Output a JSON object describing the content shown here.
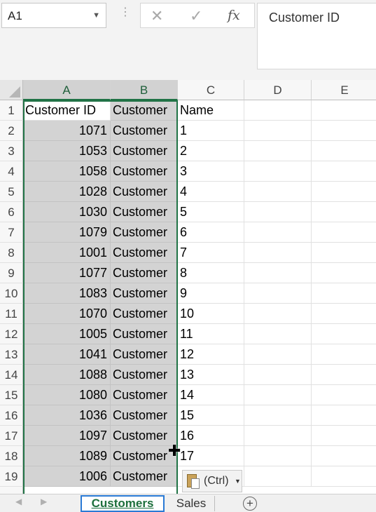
{
  "name_box": {
    "value": "A1",
    "dropdown_icon": "chevron-down-icon"
  },
  "formula_bar": {
    "cancel_icon": "close-icon",
    "enter_icon": "check-icon",
    "insert_function_icon": "fx-icon",
    "insert_function_label": "fx",
    "content": "Customer ID"
  },
  "columns": [
    "A",
    "B",
    "C",
    "D",
    "E"
  ],
  "rows": [
    {
      "n": "1",
      "a": "Customer ID",
      "b": "Customer",
      "c": "Name"
    },
    {
      "n": "2",
      "a": "1071",
      "b": "Customer",
      "c": "1"
    },
    {
      "n": "3",
      "a": "1053",
      "b": "Customer",
      "c": "2"
    },
    {
      "n": "4",
      "a": "1058",
      "b": "Customer",
      "c": "3"
    },
    {
      "n": "5",
      "a": "1028",
      "b": "Customer",
      "c": "4"
    },
    {
      "n": "6",
      "a": "1030",
      "b": "Customer",
      "c": "5"
    },
    {
      "n": "7",
      "a": "1079",
      "b": "Customer",
      "c": "6"
    },
    {
      "n": "8",
      "a": "1001",
      "b": "Customer",
      "c": "7"
    },
    {
      "n": "9",
      "a": "1077",
      "b": "Customer",
      "c": "8"
    },
    {
      "n": "10",
      "a": "1083",
      "b": "Customer",
      "c": "9"
    },
    {
      "n": "11",
      "a": "1070",
      "b": "Customer",
      "c": "10"
    },
    {
      "n": "12",
      "a": "1005",
      "b": "Customer",
      "c": "11"
    },
    {
      "n": "13",
      "a": "1041",
      "b": "Customer",
      "c": "12"
    },
    {
      "n": "14",
      "a": "1088",
      "b": "Customer",
      "c": "13"
    },
    {
      "n": "15",
      "a": "1080",
      "b": "Customer",
      "c": "14"
    },
    {
      "n": "16",
      "a": "1036",
      "b": "Customer",
      "c": "15"
    },
    {
      "n": "17",
      "a": "1097",
      "b": "Customer",
      "c": "16"
    },
    {
      "n": "18",
      "a": "1089",
      "b": "Customer",
      "c": "17"
    },
    {
      "n": "19",
      "a": "1006",
      "b": "Customer",
      "c": ""
    }
  ],
  "paste_options": {
    "label": "(Ctrl)",
    "icon": "clipboard-icon",
    "arrow_icon": "caret-down-icon"
  },
  "sheet_tabs": {
    "nav_prev_icon": "triangle-left-icon",
    "nav_next_icon": "triangle-right-icon",
    "tabs": [
      {
        "label": "Customers",
        "active": true
      },
      {
        "label": "Sales",
        "active": false
      }
    ],
    "add_icon": "plus-circle-icon",
    "add_label": "+"
  },
  "colors": {
    "selection_border": "#217346",
    "selection_fill": "#d3d3d3",
    "active_tab_outline": "#2a7ad5"
  }
}
